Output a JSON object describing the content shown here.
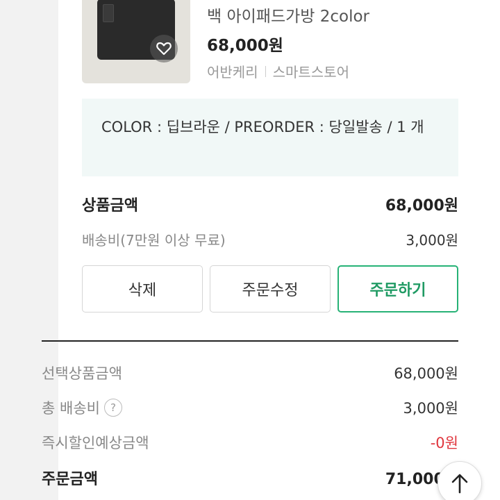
{
  "product": {
    "name": "백 아이패드가방 2color",
    "price": "68,000원",
    "store": "어반케리",
    "channel": "스마트스토어"
  },
  "option": {
    "text": "COLOR : 딥브라운 / PREORDER : 당일발송 / 1 개"
  },
  "item_summary": {
    "product_amount_label": "상품금액",
    "product_amount_value": "68,000원",
    "shipping_label": "배송비(7만원 이상 무료)",
    "shipping_value": "3,000원"
  },
  "buttons": {
    "delete": "삭제",
    "edit_order": "주문수정",
    "order": "주문하기"
  },
  "totals": {
    "selected_label": "선택상품금액",
    "selected_value": "68,000원",
    "total_shipping_label": "총 배송비",
    "total_shipping_value": "3,000원",
    "discount_label": "즉시할인예상금액",
    "discount_value": "-0원",
    "order_amount_label": "주문금액",
    "order_amount_value": "71,000원"
  },
  "colors": {
    "accent_green": "#26b276",
    "discount_red": "#e0353d",
    "option_bg": "#f1f8f7"
  },
  "icons": {
    "help": "?"
  }
}
